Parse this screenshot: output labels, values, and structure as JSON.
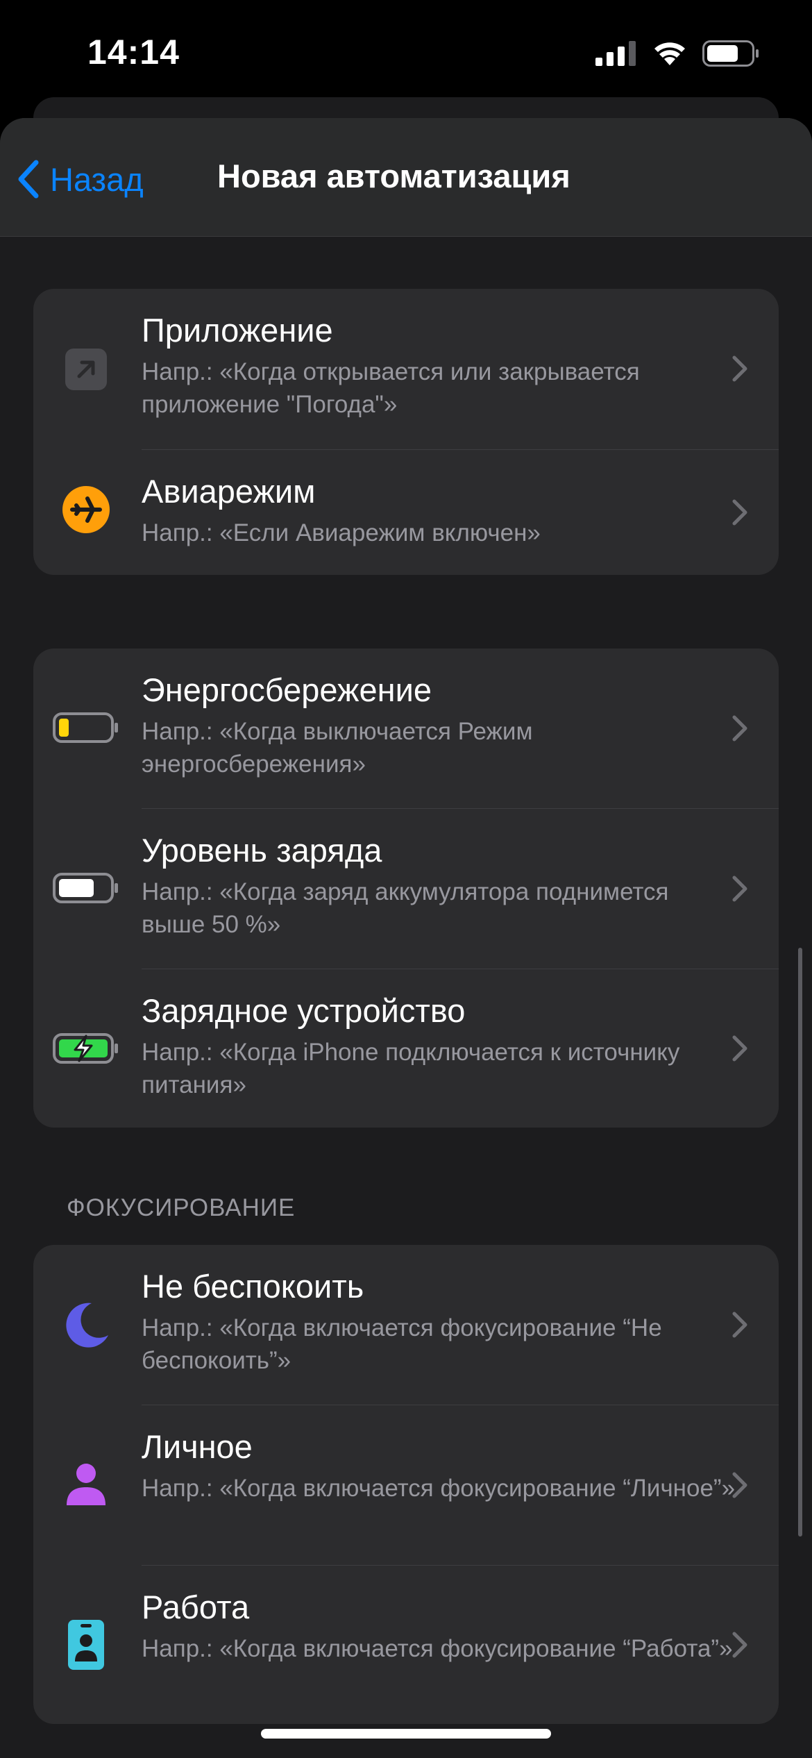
{
  "status_bar": {
    "time": "14:14"
  },
  "nav": {
    "back_label": "Назад",
    "title": "Новая автоматизация"
  },
  "groups": [
    {
      "items": [
        {
          "title": "Приложение",
          "subtitle": "Напр.: «Когда открывается или закрывается приложение \"Погода\"»",
          "icon": "app-arrow-icon"
        },
        {
          "title": "Авиарежим",
          "subtitle": "Напр.: «Если Авиарежим включен»",
          "icon": "airplane-icon",
          "color": "#ff9f0a"
        }
      ]
    },
    {
      "items": [
        {
          "title": "Энергосбережение",
          "subtitle": "Напр.: «Когда выключается Режим энергосбережения»",
          "icon": "battery-low-icon",
          "color": "#ffd60a"
        },
        {
          "title": "Уровень заряда",
          "subtitle": "Напр.: «Когда заряд аккумулятора поднимется выше 50 %»",
          "icon": "battery-full-icon"
        },
        {
          "title": "Зарядное устройство",
          "subtitle": "Напр.: «Когда iPhone подключается к источнику питания»",
          "icon": "battery-charging-icon",
          "color": "#32d74b"
        }
      ]
    },
    {
      "header": "ФОКУСИРОВАНИЕ",
      "items": [
        {
          "title": "Не беспокоить",
          "subtitle": "Напр.: «Когда включается фокусирование “Не беспокоить”»",
          "icon": "moon-icon",
          "color": "#5e5ce6"
        },
        {
          "title": "Личное",
          "subtitle": "Напр.: «Когда включается фокусирование “Личное”»",
          "icon": "person-icon",
          "color": "#bf5af2"
        },
        {
          "title": "Работа",
          "subtitle": "Напр.: «Когда включается фокусирование “Работа”»",
          "icon": "id-badge-icon",
          "color": "#40c8e0"
        }
      ]
    }
  ],
  "colors": {
    "accent": "#0a84ff",
    "background": "#1c1c1e",
    "cell": "#2c2c2e",
    "secondary_text": "#98989f"
  }
}
